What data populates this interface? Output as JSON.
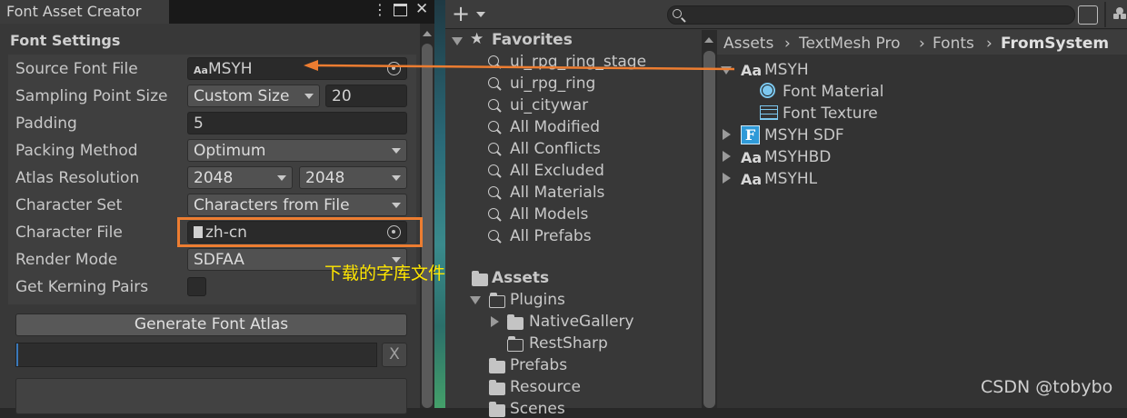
{
  "font_asset_creator": {
    "tab_title": "Font Asset Creator",
    "section_title": "Font Settings",
    "fields": {
      "source_font_file": {
        "label": "Source Font File",
        "value": "MSYH",
        "icon_text": "Aa"
      },
      "sampling_point_size": {
        "label": "Sampling Point Size",
        "mode": "Custom Size",
        "value": "20"
      },
      "padding": {
        "label": "Padding",
        "value": "5"
      },
      "packing_method": {
        "label": "Packing Method",
        "value": "Optimum"
      },
      "atlas_resolution": {
        "label": "Atlas Resolution",
        "width": "2048",
        "height": "2048"
      },
      "character_set": {
        "label": "Character Set",
        "value": "Characters from File"
      },
      "character_file": {
        "label": "Character File",
        "value": "zh-cn"
      },
      "render_mode": {
        "label": "Render Mode",
        "value": "SDFAA"
      },
      "get_kerning_pairs": {
        "label": "Get Kerning Pairs",
        "checked": false
      }
    },
    "generate_button": "Generate Font Atlas",
    "clear_button": "X",
    "progress": 0
  },
  "project": {
    "favorites": {
      "title": "Favorites",
      "items": [
        "ui_rpg_ring_stage",
        "ui_rpg_ring",
        "ui_citywar",
        "All Modified",
        "All Conflicts",
        "All Excluded",
        "All Materials",
        "All Models",
        "All Prefabs"
      ]
    },
    "assets_tree": {
      "title": "Assets",
      "plugins": "Plugins",
      "native_gallery": "NativeGallery",
      "rest_sharp": "RestSharp",
      "prefabs": "Prefabs",
      "resource": "Resource",
      "scenes": "Scenes"
    },
    "breadcrumb": [
      "Assets",
      "TextMesh Pro",
      "Fonts",
      "FromSystem"
    ],
    "files": {
      "msyh": {
        "name": "MSYH",
        "icon_text": "Aa"
      },
      "font_material": "Font Material",
      "font_texture": "Font Texture",
      "msyh_sdf": {
        "name": "MSYH SDF",
        "icon_text": "F"
      },
      "msyhbd": {
        "name": "MSYHBD",
        "icon_text": "Aa"
      },
      "msyhl": {
        "name": "MSYHL",
        "icon_text": "Aa"
      }
    }
  },
  "annotation": {
    "text": "下载的字库文件",
    "arrow_color": "#ed7d31",
    "text_color": "#ffe600"
  },
  "watermark": "CSDN @tobybo",
  "colors": {
    "panel": "#383838",
    "field": "#2a2a2a",
    "dropdown": "#515151",
    "accent_orange": "#ed7d31"
  }
}
